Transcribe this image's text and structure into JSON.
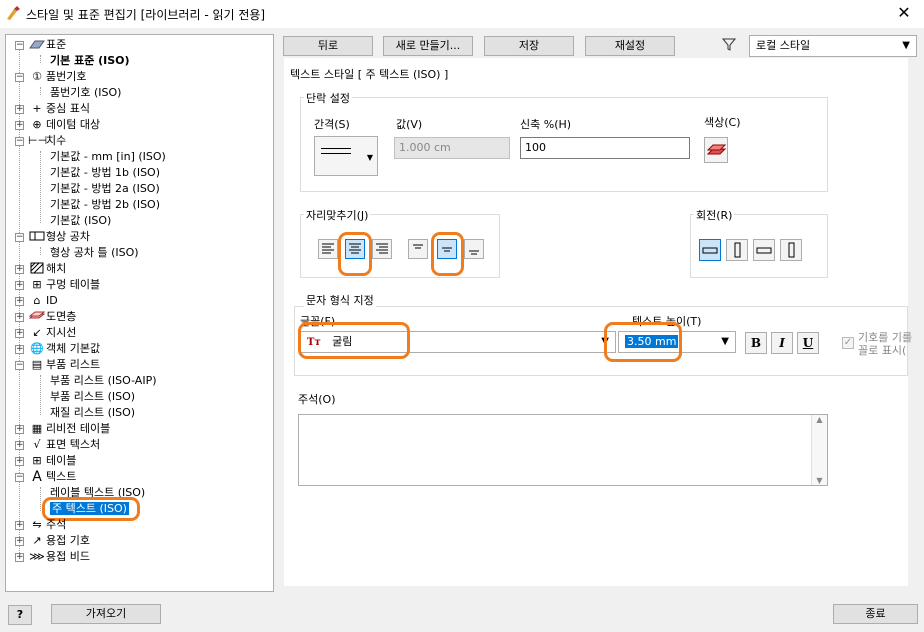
{
  "window": {
    "title": "스타일 및 표준 편집기 [라이브러리 - 읽기 전용]",
    "close_glyph": "✕"
  },
  "tree": {
    "n0": "표준",
    "n1": "기본 표준 (ISO)",
    "n2": "품번기호",
    "n3": "품번기호 (ISO)",
    "n4": "중심 표식",
    "n5": "데이텀 대상",
    "n6": "치수",
    "n7": "기본값 - mm [in] (ISO)",
    "n8": "기본값 - 방법 1b (ISO)",
    "n9": "기본값 - 방법 2a (ISO)",
    "n10": "기본값 - 방법 2b (ISO)",
    "n11": "기본값 (ISO)",
    "n12": "형상 공차",
    "n13": "형상 공차 틀 (ISO)",
    "n14": "해치",
    "n15": "구멍 테이블",
    "n16": "ID",
    "n17": "도면층",
    "n18": "지시선",
    "n19": "객체 기본값",
    "n20": "부품 리스트",
    "n21": "부품 리스트 (ISO-AIP)",
    "n22": "부품 리스트 (ISO)",
    "n23": "재질 리스트 (ISO)",
    "n24": "리비전 테이블",
    "n25": "표면 텍스처",
    "n26": "테이블",
    "n27": "텍스트",
    "n28": "레이블 텍스트 (ISO)",
    "n29": "주 텍스트 (ISO)",
    "n30": "주석",
    "n31": "용접 기호",
    "n32": "용접 비드"
  },
  "toolbar": {
    "back": "뒤로",
    "new": "새로 만들기...",
    "save": "저장",
    "reset": "재설정",
    "filter": "로컬 스타일"
  },
  "panel": {
    "heading": "텍스트 스타일 [ 주 텍스트 (ISO) ]",
    "para_group": "단락 설정",
    "spacing_label": "간격(S)",
    "value_label": "값(V)",
    "value": "1.000 cm",
    "stretch_label": "신축 %(H)",
    "stretch_value": "100",
    "color_label": "색상(C)",
    "justify_group": "자리맞추기(J)",
    "rotate_group": "회전(R)",
    "format_group": "문자 형식 지정",
    "font_label": "글꼴(F)",
    "font_value": "굴림",
    "font_icon": "Tт",
    "height_label": "텍스트 높이(T)",
    "height_value": "3.50 mm",
    "bold": "B",
    "italic": "I",
    "underline": "U",
    "symbol_label_1": "기호를 기를",
    "symbol_label_2": "꼴로 표시(",
    "note_label": "주석(O)"
  },
  "footer": {
    "help": "?",
    "import": "가져오기",
    "close": "종료"
  },
  "colors": {
    "highlight": "#f07c1e",
    "selection": "#0078d7"
  }
}
